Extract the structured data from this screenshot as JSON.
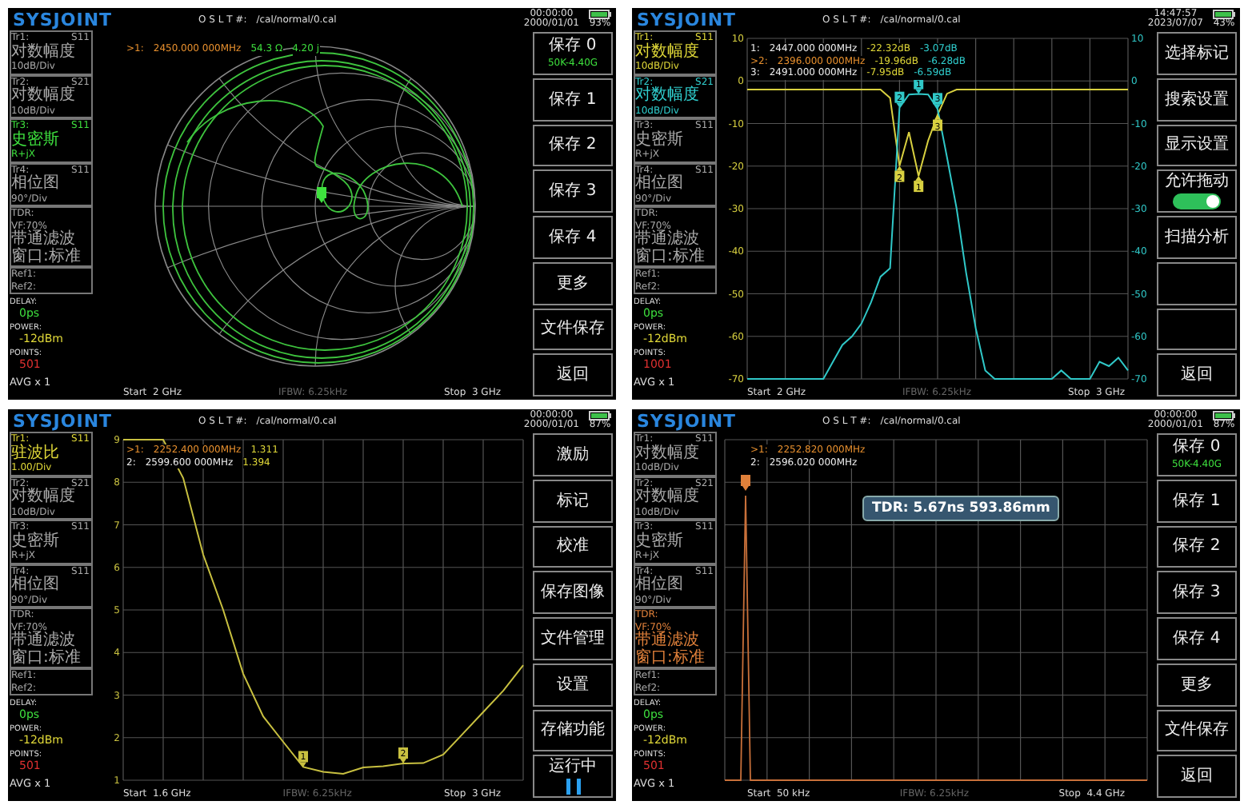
{
  "panels": [
    {
      "header": {
        "logo": "SYSJOINT",
        "cal_label": "O S L T #:",
        "cal_path": "/cal/normal/0.cal",
        "time": "00:00:00",
        "date": "2000/01/01",
        "battery": "93%"
      },
      "traces": [
        {
          "id": "Tr1:",
          "param": "S11",
          "format": "对数幅度",
          "scale": "10dB/Div",
          "active": false
        },
        {
          "id": "Tr2:",
          "param": "S21",
          "format": "对数幅度",
          "scale": "10dB/Div",
          "active": false
        },
        {
          "id": "Tr3:",
          "param": "S11",
          "format": "史密斯",
          "scale": "R+jX",
          "active": true,
          "color": "#3ee03e"
        },
        {
          "id": "Tr4:",
          "param": "S11",
          "format": "相位图",
          "scale": "90°/Div",
          "active": false
        }
      ],
      "tdr": {
        "title": "TDR:",
        "vf": "VF:70%",
        "filter": "带通滤波",
        "window": "窗口:标准",
        "active": false
      },
      "refs": [
        "Ref1:",
        "Ref2:"
      ],
      "status": {
        "delay_label": "DELAY:",
        "delay": "0ps",
        "power_label": "POWER:",
        "power": "-12dBm",
        "points_label": "POINTS:",
        "points": "501",
        "avg": "AVG x 1"
      },
      "markers": [
        {
          "id": ">1:",
          "freq": "2450.000 000MHz",
          "active": true,
          "values": [
            {
              "text": "54.3 Ω",
              "color": "#3ee03e"
            },
            {
              "text": "4.20 j",
              "color": "#3ee03e"
            }
          ]
        }
      ],
      "plot": {
        "kind": "smith"
      },
      "footer": {
        "start": "Start  2 GHz",
        "ifbw": "IFBW: 6.25kHz",
        "stop": "Stop  3 GHz"
      },
      "buttons": [
        {
          "kind": "plain",
          "label": "保存 0",
          "sublabel": "50K-4.40G"
        },
        {
          "kind": "plain",
          "label": "保存 1"
        },
        {
          "kind": "plain",
          "label": "保存 2"
        },
        {
          "kind": "plain",
          "label": "保存 3"
        },
        {
          "kind": "plain",
          "label": "保存 4"
        },
        {
          "kind": "plain",
          "label": "更多"
        },
        {
          "kind": "plain",
          "label": "文件保存"
        },
        {
          "kind": "plain",
          "label": "返回"
        }
      ]
    },
    {
      "header": {
        "logo": "SYSJOINT",
        "cal_label": "O S L T #:",
        "cal_path": "/cal/normal/0.cal",
        "time": "14:47:57",
        "date": "2023/07/07",
        "battery": "43%"
      },
      "traces": [
        {
          "id": "Tr1:",
          "param": "S11",
          "format": "对数幅度",
          "scale": "10dB/Div",
          "active": true,
          "color": "#e0d838"
        },
        {
          "id": "Tr2:",
          "param": "S21",
          "format": "对数幅度",
          "scale": "10dB/Div",
          "active": true,
          "color": "#30d0d0"
        },
        {
          "id": "Tr3:",
          "param": "S11",
          "format": "史密斯",
          "scale": "R+jX",
          "active": false
        },
        {
          "id": "Tr4:",
          "param": "S11",
          "format": "相位图",
          "scale": "90°/Div",
          "active": false
        }
      ],
      "tdr": {
        "title": "TDR:",
        "vf": "VF:70%",
        "filter": "带通滤波",
        "window": "窗口:标准",
        "active": false
      },
      "refs": [
        "Ref1:",
        "Ref2:"
      ],
      "status": {
        "delay_label": "DELAY:",
        "delay": "0ps",
        "power_label": "POWER:",
        "power": "-12dBm",
        "points_label": "POINTS:",
        "points": "1001",
        "avg": "AVG x 1"
      },
      "markers": [
        {
          "id": "1:",
          "freq": "2447.000 000MHz",
          "active": false,
          "values": [
            {
              "text": "-22.32dB",
              "color": "#e0d838"
            },
            {
              "text": "-3.07dB",
              "color": "#30d0d0"
            }
          ]
        },
        {
          "id": ">2:",
          "freq": "2396.000 000MHz",
          "active": true,
          "values": [
            {
              "text": "-19.96dB",
              "color": "#e0d838"
            },
            {
              "text": "-6.28dB",
              "color": "#30d0d0"
            }
          ]
        },
        {
          "id": "3:",
          "freq": "2491.000 000MHz",
          "active": false,
          "values": [
            {
              "text": "-7.95dB",
              "color": "#e0d838"
            },
            {
              "text": "-6.59dB",
              "color": "#30d0d0"
            }
          ]
        }
      ],
      "plot": {
        "kind": "rect",
        "right_ticks": [
          "10",
          "0",
          "-10",
          "-20",
          "-30",
          "-40",
          "-50",
          "-60",
          "-70"
        ],
        "chart_data": {
          "type": "line",
          "categories": [
            null,
            null,
            null,
            null,
            null,
            null,
            null,
            null,
            null,
            null,
            null,
            null,
            null,
            null,
            null,
            null,
            null,
            null,
            null,
            null,
            null,
            null,
            null,
            null,
            null,
            null,
            null,
            null,
            null,
            null,
            null,
            null,
            null,
            null,
            null,
            null,
            null,
            null,
            null,
            null,
            null
          ],
          "ylim": [
            -70,
            10
          ],
          "yticks": [
            10,
            0,
            -10,
            -20,
            -30,
            -40,
            -50,
            -60,
            -70
          ],
          "grid": true,
          "series": [
            {
              "color": "#d8d040",
              "values": [
                -2,
                -2,
                -2,
                -2,
                -2,
                -2,
                -2,
                -2,
                -2,
                -2,
                -2,
                -2,
                -2,
                -2,
                -2,
                -4,
                -19.96,
                -12,
                -22.32,
                -14,
                -7.95,
                -3,
                -2,
                -2,
                -2,
                -2,
                -2,
                -2,
                -2,
                -2,
                -2,
                -2,
                -2,
                -2,
                -2,
                -2,
                -2,
                -2,
                -2,
                -2,
                -2
              ]
            },
            {
              "color": "#30c8c8",
              "values": [
                -70,
                -70,
                -70,
                -70,
                -70,
                -70,
                -70,
                -70,
                -70,
                -66,
                -62,
                -60,
                -57,
                -52,
                -46,
                -44,
                -6.28,
                -3.2,
                -3.07,
                -3.2,
                -6.59,
                -18,
                -30,
                -45,
                -58,
                -68,
                -70,
                -70,
                -70,
                -70,
                -70,
                -70,
                -70,
                -68,
                -70,
                -70,
                -70,
                -66,
                -67,
                -65,
                -68
              ]
            }
          ],
          "annotations": [
            {
              "y": -22.32,
              "text": "1"
            },
            {
              "y": -19.96,
              "text": "2"
            },
            {
              "y": -7.95,
              "text": "3"
            },
            {
              "y": -3.07,
              "text": "1"
            },
            {
              "y": -6.28,
              "text": "2"
            },
            {
              "y": -6.59,
              "text": "3"
            }
          ]
        }
      },
      "footer": {
        "start": "Start  2 GHz",
        "ifbw": "IFBW: 6.25kHz",
        "stop": "Stop  3 GHz"
      },
      "buttons": [
        {
          "kind": "plain",
          "label": "选择标记"
        },
        {
          "kind": "plain",
          "label": "搜索设置"
        },
        {
          "kind": "plain",
          "label": "显示设置"
        },
        {
          "kind": "toggle",
          "label": "允许拖动",
          "on": true
        },
        {
          "kind": "plain",
          "label": "扫描分析"
        },
        {
          "kind": "empty"
        },
        {
          "kind": "empty"
        },
        {
          "kind": "plain",
          "label": "返回"
        }
      ]
    },
    {
      "header": {
        "logo": "SYSJOINT",
        "cal_label": "O S L T #:",
        "cal_path": "/cal/normal/0.cal",
        "time": "00:00:00",
        "date": "2000/01/01",
        "battery": "87%"
      },
      "traces": [
        {
          "id": "Tr1:",
          "param": "S11",
          "format": "驻波比",
          "scale": "1.00/Div",
          "active": true,
          "color": "#e0d838"
        },
        {
          "id": "Tr2:",
          "param": "S21",
          "format": "对数幅度",
          "scale": "10dB/Div",
          "active": false
        },
        {
          "id": "Tr3:",
          "param": "S11",
          "format": "史密斯",
          "scale": "R+jX",
          "active": false
        },
        {
          "id": "Tr4:",
          "param": "S11",
          "format": "相位图",
          "scale": "90°/Div",
          "active": false
        }
      ],
      "tdr": {
        "title": "TDR:",
        "vf": "VF:70%",
        "filter": "带通滤波",
        "window": "窗口:标准",
        "active": false
      },
      "refs": [
        "Ref1:",
        "Ref2:"
      ],
      "status": {
        "delay_label": "DELAY:",
        "delay": "0ps",
        "power_label": "POWER:",
        "power": "-12dBm",
        "points_label": "POINTS:",
        "points": "501",
        "avg": "AVG x 1"
      },
      "markers": [
        {
          "id": ">1:",
          "freq": "2252.400 000MHz",
          "active": true,
          "values": [
            {
              "text": "1.311",
              "color": "#e0d838"
            }
          ]
        },
        {
          "id": "2:",
          "freq": "2599.600 000MHz",
          "active": false,
          "values": [
            {
              "text": "1.394",
              "color": "#e0d838"
            }
          ]
        }
      ],
      "plot": {
        "kind": "rect",
        "chart_data": {
          "type": "line",
          "categories": [
            null,
            null,
            null,
            null,
            null,
            null,
            null,
            null,
            null,
            null,
            null,
            null,
            null,
            null,
            null,
            null,
            null,
            null,
            null,
            null,
            null
          ],
          "ylim": [
            1,
            9
          ],
          "yticks": [
            9,
            8,
            7,
            6,
            5,
            4,
            3,
            2,
            1
          ],
          "grid": true,
          "series": [
            {
              "color": "#c8c040",
              "values": [
                9,
                9,
                9,
                8.1,
                6.3,
                5,
                3.5,
                2.5,
                1.9,
                1.311,
                1.2,
                1.15,
                1.3,
                1.33,
                1.394,
                1.4,
                1.6,
                2.1,
                2.6,
                3.1,
                3.7
              ]
            }
          ],
          "annotations": [
            {
              "y": 1.311,
              "text": "1"
            },
            {
              "y": 1.394,
              "text": "2"
            }
          ]
        }
      },
      "footer": {
        "start": "Start  1.6 GHz",
        "ifbw": "IFBW: 6.25kHz",
        "stop": "Stop  3 GHz"
      },
      "buttons": [
        {
          "kind": "plain",
          "label": "激励"
        },
        {
          "kind": "plain",
          "label": "标记"
        },
        {
          "kind": "plain",
          "label": "校准"
        },
        {
          "kind": "plain",
          "label": "保存图像"
        },
        {
          "kind": "plain",
          "label": "文件管理"
        },
        {
          "kind": "plain",
          "label": "设置"
        },
        {
          "kind": "plain",
          "label": "存储功能"
        },
        {
          "kind": "run",
          "label": "运行中"
        }
      ]
    },
    {
      "header": {
        "logo": "SYSJOINT",
        "cal_label": "O S L T #:",
        "cal_path": "/cal/normal/0.cal",
        "time": "00:00:00",
        "date": "2000/01/01",
        "battery": "87%"
      },
      "traces": [
        {
          "id": "Tr1:",
          "param": "S11",
          "format": "对数幅度",
          "scale": "10dB/Div",
          "active": false
        },
        {
          "id": "Tr2:",
          "param": "S21",
          "format": "对数幅度",
          "scale": "10dB/Div",
          "active": false
        },
        {
          "id": "Tr3:",
          "param": "S11",
          "format": "史密斯",
          "scale": "R+jX",
          "active": false
        },
        {
          "id": "Tr4:",
          "param": "S11",
          "format": "相位图",
          "scale": "90°/Div",
          "active": false
        }
      ],
      "tdr": {
        "title": "TDR:",
        "vf": "VF:70%",
        "filter": "带通滤波",
        "window": "窗口:标准",
        "active": true,
        "color": "#e0803a"
      },
      "refs": [
        "Ref1:",
        "Ref2:"
      ],
      "status": {
        "delay_label": "DELAY:",
        "delay": "0ps",
        "power_label": "POWER:",
        "power": "-12dBm",
        "points_label": "POINTS:",
        "points": "501",
        "avg": "AVG x 1"
      },
      "markers": [
        {
          "id": ">1:",
          "freq": "2252.820 000MHz",
          "active": true
        },
        {
          "id": "2:",
          "freq": "2596.020 000MHz",
          "active": false
        }
      ],
      "plot": {
        "kind": "tdr",
        "readout": "TDR: 5.67ns 593.86mm"
      },
      "footer": {
        "start": "Start  50 kHz",
        "ifbw": "IFBW: 6.25kHz",
        "stop": "Stop  4.4 GHz"
      },
      "buttons": [
        {
          "kind": "plain",
          "label": "保存 0",
          "sublabel": "50K-4.40G"
        },
        {
          "kind": "plain",
          "label": "保存 1"
        },
        {
          "kind": "plain",
          "label": "保存 2"
        },
        {
          "kind": "plain",
          "label": "保存 3"
        },
        {
          "kind": "plain",
          "label": "保存 4"
        },
        {
          "kind": "plain",
          "label": "更多"
        },
        {
          "kind": "plain",
          "label": "文件保存"
        },
        {
          "kind": "plain",
          "label": "返回"
        }
      ]
    }
  ]
}
